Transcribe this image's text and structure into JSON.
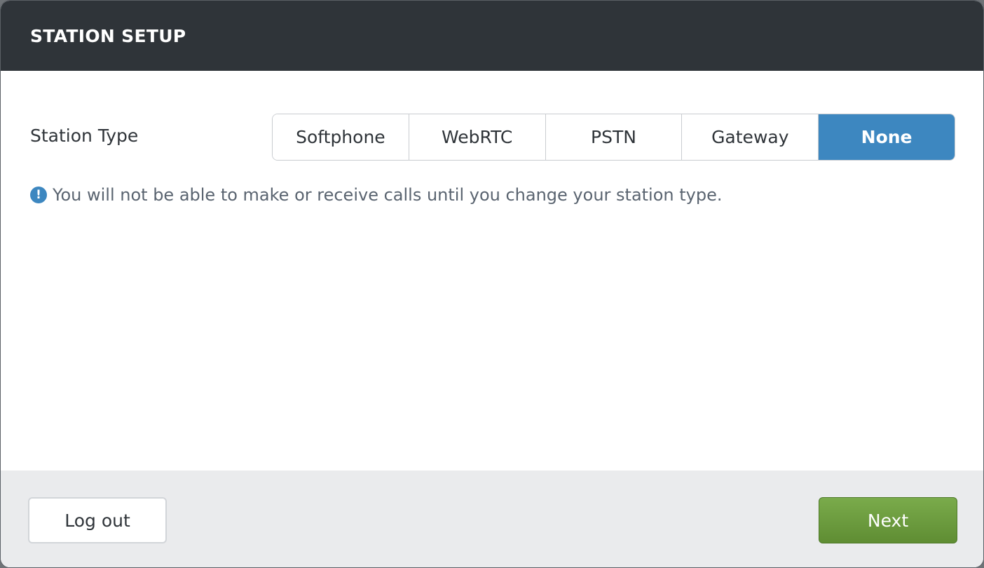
{
  "header": {
    "title": "STATION SETUP"
  },
  "station": {
    "label": "Station Type",
    "options": [
      "Softphone",
      "WebRTC",
      "PSTN",
      "Gateway",
      "None"
    ],
    "selected": "None"
  },
  "notice": {
    "icon": "exclamation-circle-icon",
    "icon_glyph": "!",
    "text": "You will not be able to make or receive calls until you change your station type."
  },
  "footer": {
    "logout_label": "Log out",
    "next_label": "Next"
  },
  "colors": {
    "header_bg": "#2f3439",
    "accent": "#3d87c0",
    "next_green": "#6a9a3e",
    "footer_bg": "#eaebed"
  }
}
